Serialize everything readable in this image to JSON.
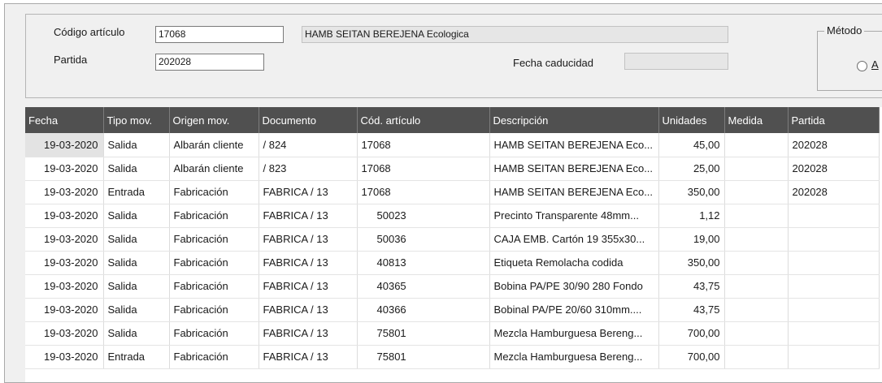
{
  "form": {
    "codigo_label": "Código artículo",
    "codigo_value": "17068",
    "descripcion_value": "HAMB SEITAN BEREJENA Ecologica",
    "partida_label": "Partida",
    "partida_value": "202028",
    "fecha_caducidad_label": "Fecha caducidad",
    "fecha_caducidad_value": "",
    "metodo_label": "Método",
    "metodo_option": "A"
  },
  "table": {
    "columns": [
      "Fecha",
      "Tipo mov.",
      "Origen mov.",
      "Documento",
      "Cód. artículo",
      "Descripción",
      "Unidades",
      "Medida",
      "Partida"
    ],
    "rows": [
      {
        "fecha": "19-03-2020",
        "tipo": "Salida",
        "origen": "Albarán cliente",
        "documento": "/ 824",
        "codigo": "17068",
        "descripcion": "HAMB SEITAN BEREJENA Eco...",
        "unidades": "45,00",
        "medida": "",
        "partida": "202028"
      },
      {
        "fecha": "19-03-2020",
        "tipo": "Salida",
        "origen": "Albarán cliente",
        "documento": "/ 823",
        "codigo": "17068",
        "descripcion": "HAMB SEITAN BEREJENA Eco...",
        "unidades": "25,00",
        "medida": "",
        "partida": "202028"
      },
      {
        "fecha": "19-03-2020",
        "tipo": "Entrada",
        "origen": "Fabricación",
        "documento": "FABRICA / 13",
        "codigo": "17068",
        "descripcion": "HAMB SEITAN BEREJENA Eco...",
        "unidades": "350,00",
        "medida": "",
        "partida": "202028"
      },
      {
        "fecha": "19-03-2020",
        "tipo": "Salida",
        "origen": "Fabricación",
        "documento": "FABRICA / 13",
        "codigo": "50023",
        "descripcion": "Precinto Transparente 48mm...",
        "unidades": "1,12",
        "medida": "",
        "partida": ""
      },
      {
        "fecha": "19-03-2020",
        "tipo": "Salida",
        "origen": "Fabricación",
        "documento": "FABRICA / 13",
        "codigo": "50036",
        "descripcion": "CAJA EMB. Cartón 19 355x30...",
        "unidades": "19,00",
        "medida": "",
        "partida": ""
      },
      {
        "fecha": "19-03-2020",
        "tipo": "Salida",
        "origen": "Fabricación",
        "documento": "FABRICA / 13",
        "codigo": "40813",
        "descripcion": "Etiqueta Remolacha codida",
        "unidades": "350,00",
        "medida": "",
        "partida": ""
      },
      {
        "fecha": "19-03-2020",
        "tipo": "Salida",
        "origen": "Fabricación",
        "documento": "FABRICA / 13",
        "codigo": "40365",
        "descripcion": "Bobina PA/PE 30/90 280  Fondo",
        "unidades": "43,75",
        "medida": "",
        "partida": ""
      },
      {
        "fecha": "19-03-2020",
        "tipo": "Salida",
        "origen": "Fabricación",
        "documento": "FABRICA / 13",
        "codigo": "40366",
        "descripcion": "Bobinal PA/PE 20/60 310mm....",
        "unidades": "43,75",
        "medida": "",
        "partida": ""
      },
      {
        "fecha": "19-03-2020",
        "tipo": "Salida",
        "origen": "Fabricación",
        "documento": "FABRICA / 13",
        "codigo": "75801",
        "descripcion": "Mezcla Hamburguesa Bereng...",
        "unidades": "700,00",
        "medida": "",
        "partida": ""
      },
      {
        "fecha": "19-03-2020",
        "tipo": "Entrada",
        "origen": "Fabricación",
        "documento": "FABRICA / 13",
        "codigo": "75801",
        "descripcion": "Mezcla Hamburguesa Bereng...",
        "unidades": "700,00",
        "medida": "",
        "partida": ""
      }
    ]
  }
}
